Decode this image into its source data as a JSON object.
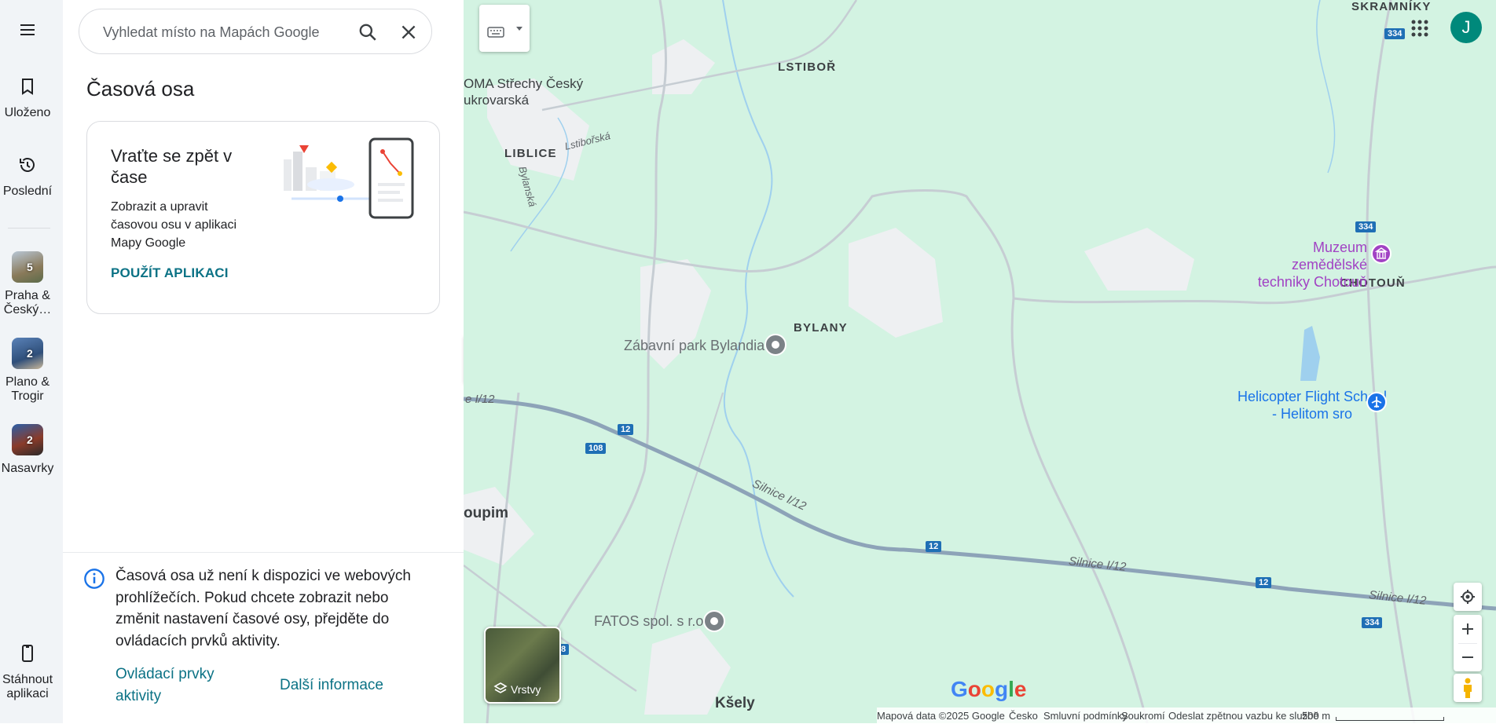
{
  "rail": {
    "saved_label": "Uloženo",
    "recent_label": "Poslední",
    "lists": [
      {
        "label_1": "Praha &",
        "label_2": "Český…",
        "count": "5"
      },
      {
        "label_1": "Plano &",
        "label_2": "Trogir",
        "count": "2"
      },
      {
        "label_1": "Nasavrky",
        "label_2": "",
        "count": "2"
      }
    ],
    "download_1": "Stáhnout",
    "download_2": "aplikaci"
  },
  "search": {
    "placeholder": "Vyhledat místo na Mapách Google"
  },
  "panel": {
    "title": "Časová osa",
    "card": {
      "heading": "Vraťte se zpět v čase",
      "text": "Zobrazit a upravit časovou osu v aplikaci Mapy Google",
      "action": "POUŽÍT APLIKACI"
    },
    "info": {
      "text": "Časová osa už není k dispozici ve webových prohlížečích. Pokud chcete zobrazit nebo změnit nastavení časové osy, přejděte do ovládacích prvků aktivity.",
      "link_activity": "Ovládací prvky aktivity",
      "link_more": "Další informace"
    }
  },
  "map": {
    "towns": [
      "SKRAMNÍKY",
      "LSTIBOŘ",
      "LIBLICE",
      "BYLANY",
      "CHOTOUŇ"
    ],
    "places": [
      "Kšely",
      "oupim",
      "OMA Střechy Český",
      "ukrovarská"
    ],
    "streets": [
      "Lstibořská",
      "Bylanská"
    ],
    "road_labels": [
      "e I/12",
      "Silnice I/12",
      "Silnice I/12",
      "Silnice I/12"
    ],
    "shields": [
      "334",
      "334",
      "12",
      "108",
      "12",
      "12",
      "334",
      "8"
    ],
    "pois": {
      "bylandia": "Zábavní park Bylandia",
      "fatos": "FATOS spol. s r.o",
      "muzeum": "Muzeum zemědělské techniky Chotouň",
      "helicopter": "Helicopter Flight School - Helitom sro"
    },
    "layers_label": "Vrstvy",
    "logo": "Google",
    "avatar_initial": "J",
    "footer": {
      "data": "Mapová data ©2025 Google",
      "country": "Česko",
      "terms": "Smluvní podmínky",
      "privacy": "Soukromí",
      "feedback": "Odeslat zpětnou vazbu ke službě",
      "scale": "500 m"
    }
  }
}
